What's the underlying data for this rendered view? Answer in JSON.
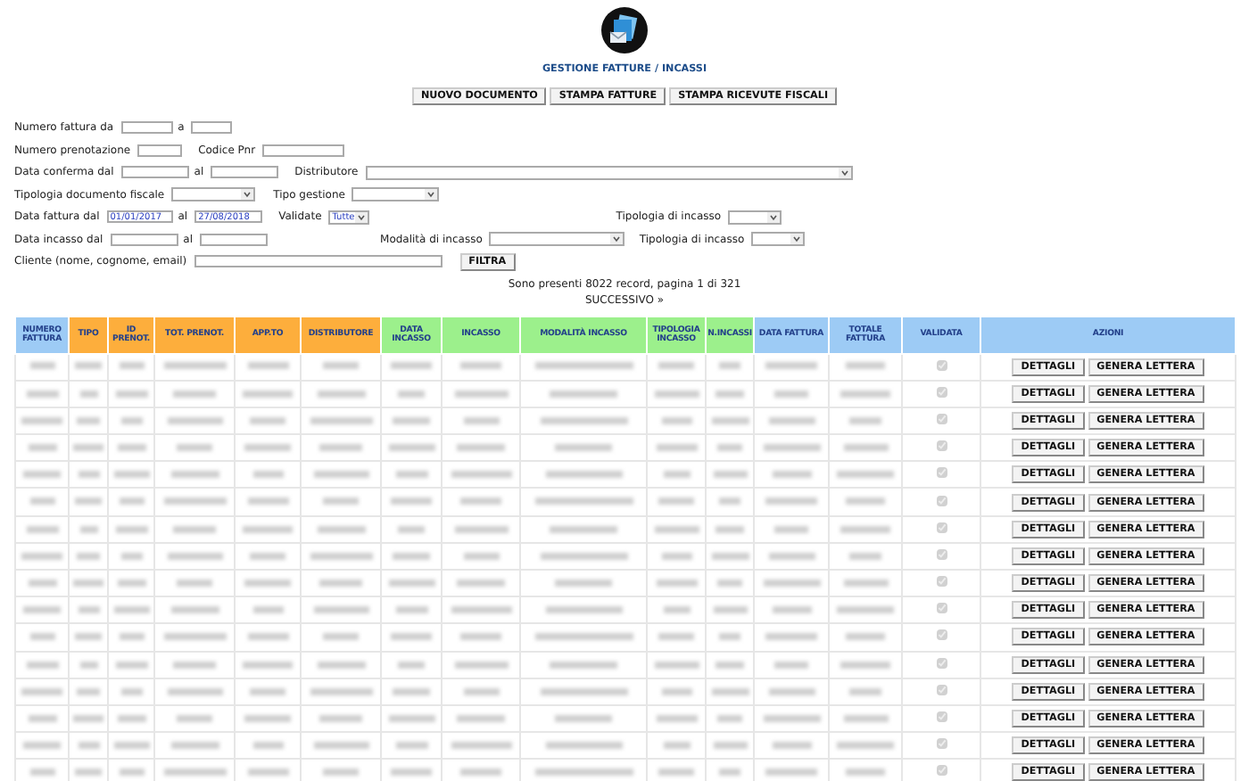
{
  "header": {
    "title": "GESTIONE FATTURE / INCASSI",
    "buttons": [
      "NUOVO DOCUMENTO",
      "STAMPA FATTURE",
      "STAMPA RICEVUTE FISCALI"
    ]
  },
  "filters": [
    [
      {
        "kind": "label",
        "text": "Numero fattura da"
      },
      {
        "kind": "input"
      },
      {
        "kind": "label",
        "text": "a"
      },
      {
        "kind": "input"
      }
    ],
    [
      {
        "kind": "label",
        "text": "Numero prenotazione"
      },
      {
        "kind": "input"
      },
      {
        "kind": "label",
        "text": "Codice Pnr"
      },
      {
        "kind": "input"
      }
    ],
    [
      {
        "kind": "label",
        "text": "Data conferma dal"
      },
      {
        "kind": "input"
      },
      {
        "kind": "label",
        "text": "al"
      },
      {
        "kind": "input"
      },
      {
        "kind": "label",
        "text": "Distributore"
      },
      {
        "kind": "select"
      }
    ],
    [
      {
        "kind": "label",
        "text": "Tipologia documento fiscale"
      },
      {
        "kind": "select"
      },
      {
        "kind": "label",
        "text": "Tipo gestione"
      },
      {
        "kind": "select"
      }
    ],
    [
      {
        "kind": "label",
        "text": "Data fattura dal"
      },
      {
        "kind": "input",
        "value": "01/01/2017"
      },
      {
        "kind": "label",
        "text": "al"
      },
      {
        "kind": "input",
        "value": "27/08/2018"
      },
      {
        "kind": "label",
        "text": "Validate"
      },
      {
        "kind": "select",
        "value": "Tutte"
      },
      {
        "kind": "label",
        "text": "Tipologia di incasso"
      },
      {
        "kind": "select"
      }
    ],
    [
      {
        "kind": "label",
        "text": "Data incasso dal"
      },
      {
        "kind": "input"
      },
      {
        "kind": "label",
        "text": "al"
      },
      {
        "kind": "input"
      },
      {
        "kind": "label",
        "text": "Modalità di incasso"
      },
      {
        "kind": "select"
      },
      {
        "kind": "label",
        "text": "Tipologia di incasso"
      },
      {
        "kind": "select"
      }
    ],
    [
      {
        "kind": "label",
        "text": "Cliente (nome, cognome, email)"
      },
      {
        "kind": "input"
      },
      {
        "kind": "button",
        "text": "FILTRA"
      }
    ]
  ],
  "results": {
    "summary": "Sono presenti 8022 record, pagina 1 di 321",
    "next_link": "SUCCESSIVO »"
  },
  "table": {
    "columns": [
      {
        "label": "NUMERO FATTURA",
        "color": "#9dcbf5"
      },
      {
        "label": "TIPO",
        "color": "#fdae3c"
      },
      {
        "label": "ID PRENOT.",
        "color": "#fdae3c"
      },
      {
        "label": "TOT. PRENOT.",
        "color": "#fdae3c"
      },
      {
        "label": "APP.TO",
        "color": "#fdae3c"
      },
      {
        "label": "DISTRIBUTORE",
        "color": "#fdae3c"
      },
      {
        "label": "DATA INCASSO",
        "color": "#9cf08c"
      },
      {
        "label": "INCASSO",
        "color": "#9cf08c"
      },
      {
        "label": "MODALITÀ INCASSO",
        "color": "#9cf08c"
      },
      {
        "label": "TIPOLOGIA INCASSO",
        "color": "#9cf08c"
      },
      {
        "label": "N.INCASSI",
        "color": "#9cf08c"
      },
      {
        "label": "DATA FATTURA",
        "color": "#9dcbf5"
      },
      {
        "label": "TOTALE FATTURA",
        "color": "#9dcbf5"
      },
      {
        "label": "VALIDATA",
        "color": "#9dcbf5"
      },
      {
        "label": "AZIONI",
        "color": "#9dcbf5"
      }
    ],
    "rows": [
      {
        "validated": true,
        "actions": [
          "DETTAGLI",
          "GENERA LETTERA"
        ]
      },
      {
        "validated": true,
        "actions": [
          "DETTAGLI",
          "GENERA LETTERA"
        ]
      },
      {
        "validated": true,
        "actions": [
          "DETTAGLI",
          "GENERA LETTERA"
        ]
      },
      {
        "validated": true,
        "actions": [
          "DETTAGLI",
          "GENERA LETTERA"
        ]
      },
      {
        "validated": true,
        "actions": [
          "DETTAGLI",
          "GENERA LETTERA"
        ]
      },
      {
        "validated": true,
        "actions": [
          "DETTAGLI",
          "GENERA LETTERA"
        ]
      },
      {
        "validated": true,
        "actions": [
          "DETTAGLI",
          "GENERA LETTERA"
        ]
      },
      {
        "validated": true,
        "actions": [
          "DETTAGLI",
          "GENERA LETTERA"
        ]
      },
      {
        "validated": true,
        "actions": [
          "DETTAGLI",
          "GENERA LETTERA"
        ]
      },
      {
        "validated": true,
        "actions": [
          "DETTAGLI",
          "GENERA LETTERA"
        ]
      },
      {
        "validated": true,
        "actions": [
          "DETTAGLI",
          "GENERA LETTERA"
        ]
      },
      {
        "validated": true,
        "actions": [
          "DETTAGLI",
          "GENERA LETTERA"
        ]
      },
      {
        "validated": true,
        "actions": [
          "DETTAGLI",
          "GENERA LETTERA"
        ]
      },
      {
        "validated": true,
        "actions": [
          "DETTAGLI",
          "GENERA LETTERA"
        ]
      },
      {
        "validated": true,
        "actions": [
          "DETTAGLI",
          "GENERA LETTERA"
        ]
      },
      {
        "validated": true,
        "actions": [
          "DETTAGLI",
          "GENERA LETTERA"
        ]
      }
    ]
  }
}
